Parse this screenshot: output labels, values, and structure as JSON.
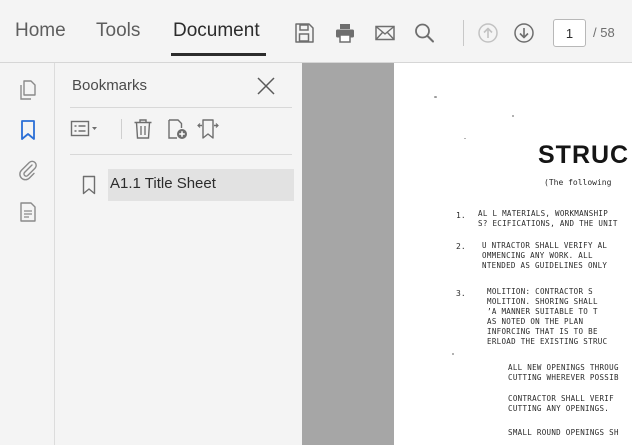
{
  "toolbar": {
    "tabs": [
      {
        "label": "Home"
      },
      {
        "label": "Tools"
      },
      {
        "label": "Document"
      }
    ],
    "icons": [
      "save-icon",
      "print-icon",
      "email-icon",
      "search-icon",
      "previous-page-icon",
      "next-page-icon"
    ],
    "page_current": "1",
    "page_total": "/ 58"
  },
  "rail": {
    "icons": [
      "pages-thumbnail-icon",
      "bookmark-icon",
      "attachment-icon",
      "document-properties-icon"
    ]
  },
  "bookmarks": {
    "title": "Bookmarks",
    "tools": [
      "options-menu-icon",
      "delete-icon",
      "new-bookmark-icon",
      "expand-bookmark-icon"
    ],
    "items": [
      {
        "label": "A1.1 Title Sheet"
      }
    ]
  },
  "document": {
    "title": "STRUC",
    "subtitle": "(The following",
    "sections": [
      {
        "number": "1.",
        "lines": [
          "AL L  MATERIALS, WORKMANSHIP",
          "S? ECIFICATIONS, AND THE UNIT"
        ]
      },
      {
        "number": "2.",
        "lines": [
          "U NTRACTOR SHALL VERIFY AL",
          "OMMENCING ANY WORK.  ALL",
          "NTENDED AS GUIDELINES ONLY"
        ]
      },
      {
        "number": "3.",
        "lines": [
          "MOLITION:  CONTRACTOR  S",
          "MOLITION.  SHORING SHALL",
          "’A MANNER SUITABLE TO T",
          "  AS NOTED ON THE PLAN",
          "INFORCING THAT IS TO BE",
          "ERLOAD THE EXISTING STRUC"
        ]
      }
    ],
    "paragraphs": [
      [
        "ALL NEW OPENINGS THROUG",
        "CUTTING WHEREVER POSSIB"
      ],
      [
        "CONTRACTOR  SHALL  VERIF",
        "CUTTING ANY OPENINGS."
      ],
      [
        "SMALL ROUND OPENINGS SH"
      ]
    ]
  },
  "colors": {
    "toolbar_bg": "#f4f4f4",
    "accent_blue": "#2b6fd6",
    "gutter_gray": "#a6a6a6",
    "icon_gray": "#6e6e6e",
    "selected_bg": "#e2e2e2"
  }
}
